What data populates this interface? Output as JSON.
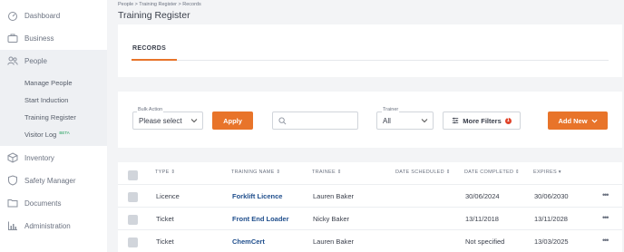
{
  "sidebar": {
    "items": [
      {
        "label": "Dashboard",
        "icon": "dashboard-icon"
      },
      {
        "label": "Business",
        "icon": "briefcase-icon"
      },
      {
        "label": "People",
        "icon": "people-icon"
      },
      {
        "label": "Inventory",
        "icon": "box-icon"
      },
      {
        "label": "Safety Manager",
        "icon": "shield-icon"
      },
      {
        "label": "Documents",
        "icon": "folder-icon"
      },
      {
        "label": "Administration",
        "icon": "chart-icon"
      }
    ],
    "people_subitems": [
      {
        "label": "Manage People"
      },
      {
        "label": "Start Induction"
      },
      {
        "label": "Training Register"
      },
      {
        "label": "Visitor Log",
        "badge": "BETA"
      }
    ]
  },
  "header": {
    "breadcrumb": "People > Training Register > Records",
    "title": "Training Register"
  },
  "tabs": {
    "records": "RECORDS"
  },
  "filters": {
    "bulk_action_label": "Bulk Action",
    "bulk_action_value": "Please select",
    "apply_label": "Apply",
    "search_placeholder": "",
    "trainer_label": "Trainer",
    "trainer_value": "All",
    "more_filters_label": "More Filters",
    "more_filters_count": "1",
    "add_new_label": "Add New"
  },
  "table": {
    "columns": [
      "TYPE",
      "TRAINING NAME",
      "TRAINEE",
      "DATE SCHEDULED",
      "DATE COMPLETED",
      "EXPIRES"
    ],
    "rows": [
      {
        "type": "Licence",
        "training_name": "Forklift Licence",
        "trainee": "Lauren Baker",
        "date_scheduled": "",
        "date_completed": "30/06/2024",
        "expires": "30/06/2030"
      },
      {
        "type": "Ticket",
        "training_name": "Front End Loader",
        "trainee": "Nicky Baker",
        "date_scheduled": "",
        "date_completed": "13/11/2018",
        "expires": "13/11/2028"
      },
      {
        "type": "Ticket",
        "training_name": "ChemCert",
        "trainee": "Lauren Baker",
        "date_scheduled": "",
        "date_completed": "Not specified",
        "expires": "13/03/2025"
      }
    ],
    "row_menu": "•••"
  },
  "colors": {
    "accent": "#e8742a",
    "link": "#1f4e8c",
    "badge": "#e0442b",
    "beta": "#22a05b"
  }
}
